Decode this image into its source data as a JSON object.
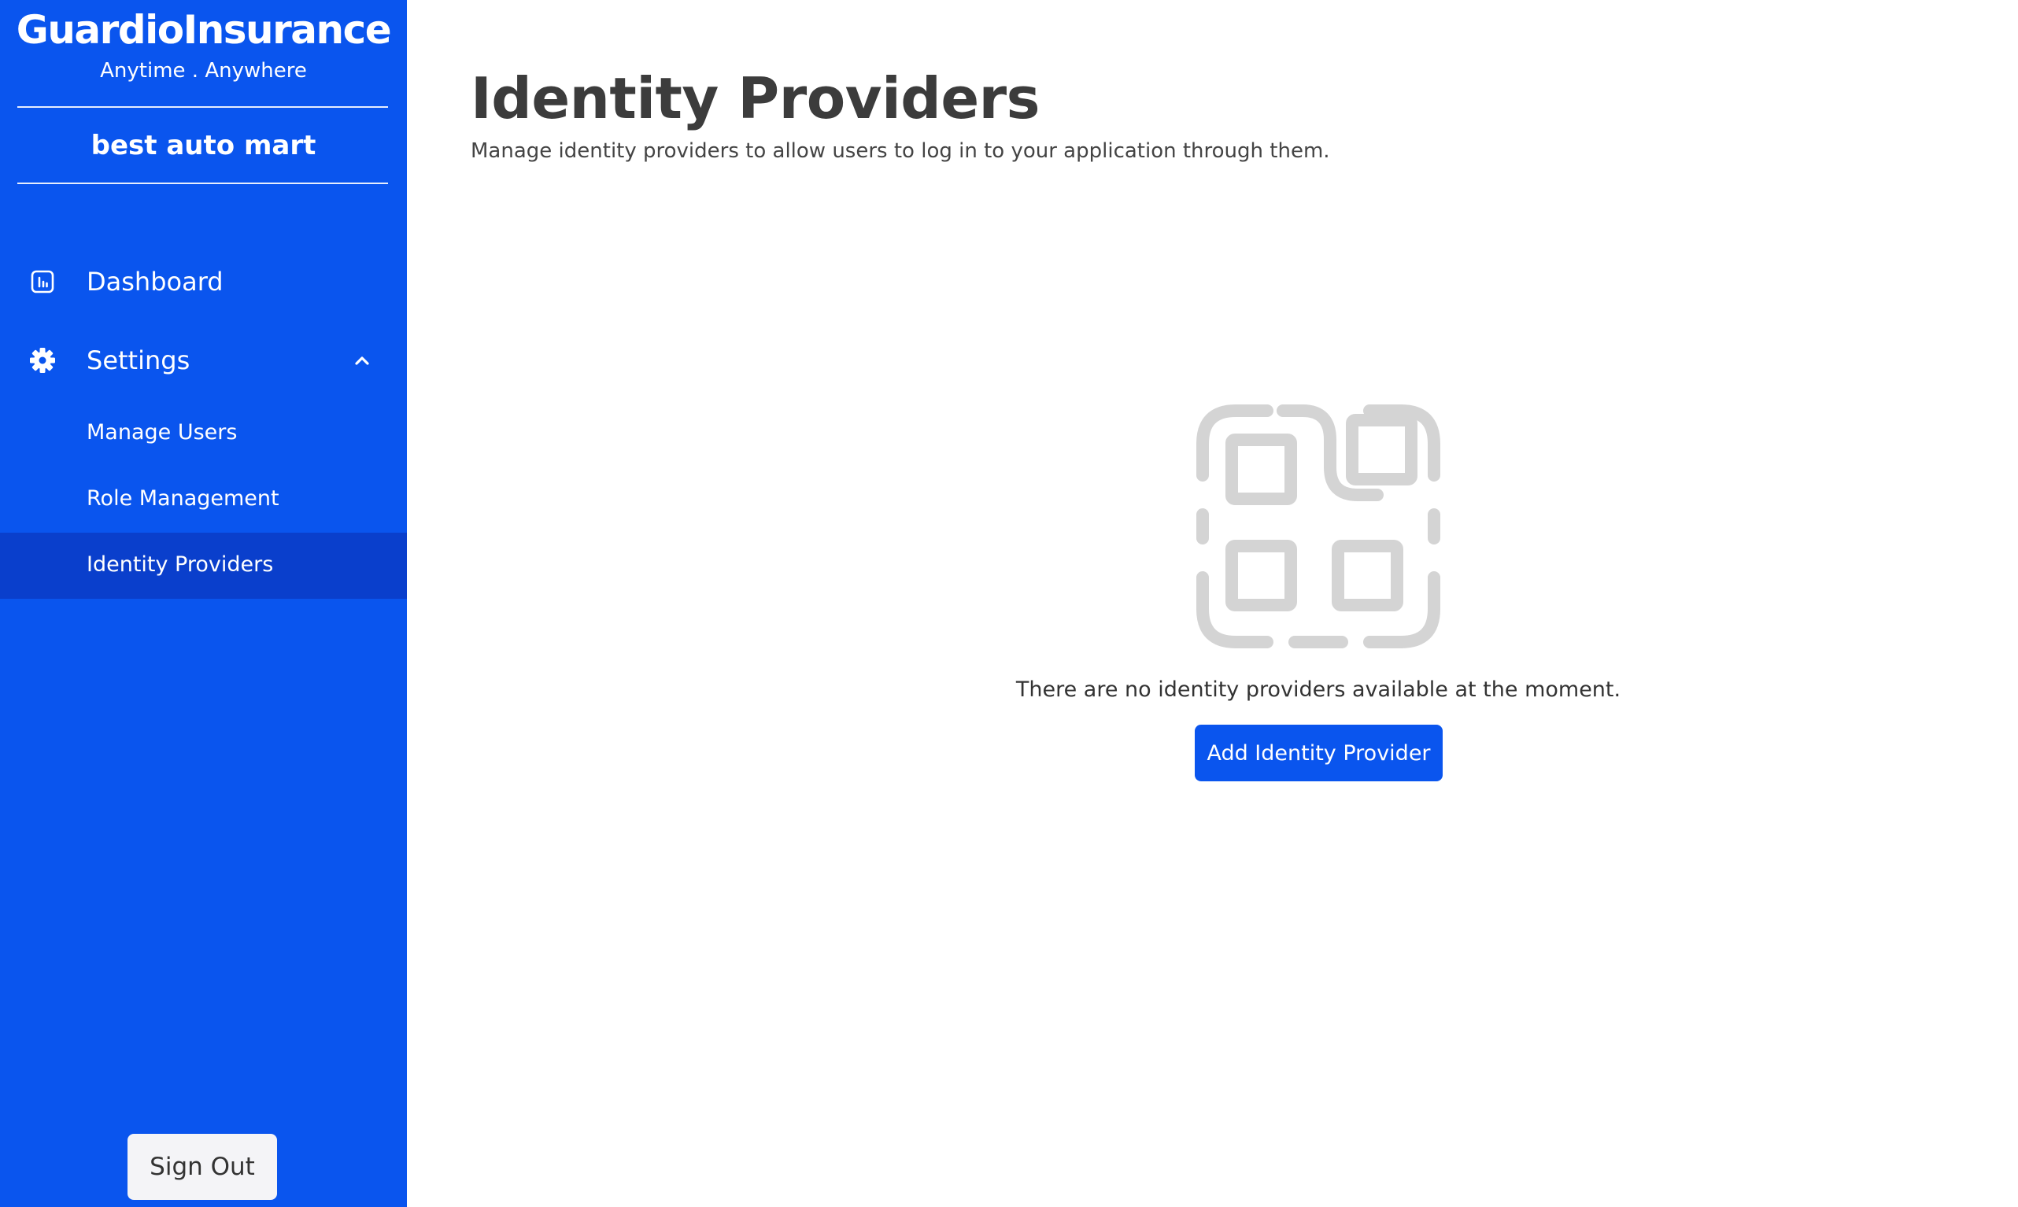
{
  "brand": {
    "name": "GuardioInsurance",
    "tagline": "Anytime . Anywhere"
  },
  "organization": {
    "name": "best auto mart"
  },
  "sidebar": {
    "items": [
      {
        "label": "Dashboard",
        "icon": "bar-chart-icon"
      },
      {
        "label": "Settings",
        "icon": "gear-icon",
        "expanded": true
      }
    ],
    "sub_items": [
      {
        "label": "Manage Users"
      },
      {
        "label": "Role Management"
      },
      {
        "label": "Identity Providers",
        "active": true
      }
    ],
    "sign_out_label": "Sign Out"
  },
  "main": {
    "title": "Identity Providers",
    "subtitle": "Manage identity providers to allow users to log in to your application through them.",
    "empty_state": {
      "icon": "qr-code-scan-icon",
      "message": "There are no identity providers available at the moment.",
      "button_label": "Add Identity Provider"
    }
  },
  "colors": {
    "sidebar_bg": "#0a55ee",
    "active_item_bg": "#0a3fcc",
    "primary_button": "#0a55ee",
    "illustration": "#d4d4d4"
  }
}
